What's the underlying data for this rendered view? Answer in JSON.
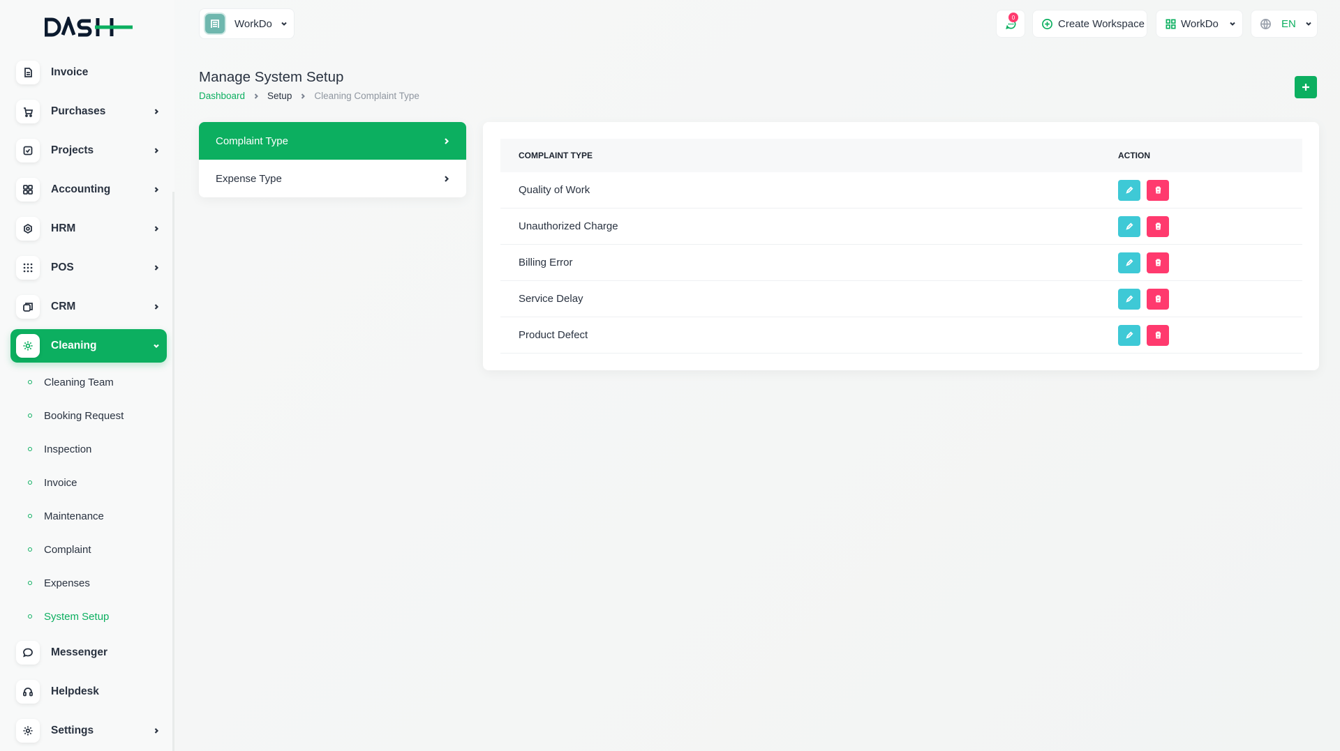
{
  "brand": {
    "logo_text": "DASH"
  },
  "sidebar": {
    "items": [
      {
        "label": "Invoice",
        "icon": "file-icon",
        "has_children": false
      },
      {
        "label": "Purchases",
        "icon": "cart-icon",
        "has_children": true
      },
      {
        "label": "Projects",
        "icon": "checkbox-icon",
        "has_children": true
      },
      {
        "label": "Accounting",
        "icon": "grid-icon",
        "has_children": true
      },
      {
        "label": "HRM",
        "icon": "hrm-icon",
        "has_children": true
      },
      {
        "label": "POS",
        "icon": "dots-grid-icon",
        "has_children": true
      },
      {
        "label": "CRM",
        "icon": "layers-icon",
        "has_children": true
      },
      {
        "label": "Cleaning",
        "icon": "sparkle-icon",
        "has_children": true,
        "active": true
      },
      {
        "label": "Messenger",
        "icon": "chat-icon",
        "has_children": false
      },
      {
        "label": "Helpdesk",
        "icon": "headset-icon",
        "has_children": false
      },
      {
        "label": "Settings",
        "icon": "gear-icon",
        "has_children": true
      }
    ],
    "cleaning_sub": [
      "Cleaning Team",
      "Booking Request",
      "Inspection",
      "Invoice",
      "Maintenance",
      "Complaint",
      "Expenses",
      "System Setup"
    ],
    "active_sub": "System Setup"
  },
  "header": {
    "workspace_name": "WorkDo",
    "notification_count": "0",
    "create_workspace": "Create Workspace",
    "workspace_menu": "WorkDo",
    "language": "EN"
  },
  "page": {
    "title": "Manage System Setup",
    "breadcrumb": [
      "Dashboard",
      "Setup",
      "Cleaning Complaint Type"
    ]
  },
  "setup_menu": {
    "items": [
      "Complaint Type",
      "Expense Type"
    ],
    "active": "Complaint Type"
  },
  "table": {
    "columns": [
      "COMPLAINT TYPE",
      "ACTION"
    ],
    "rows": [
      "Quality of Work",
      "Unauthorized Charge",
      "Billing Error",
      "Service Delay",
      "Product Defect"
    ]
  },
  "colors": {
    "primary": "#0caf60",
    "edit": "#3ec9d6",
    "delete": "#ff3a6e",
    "text": "#293240"
  }
}
